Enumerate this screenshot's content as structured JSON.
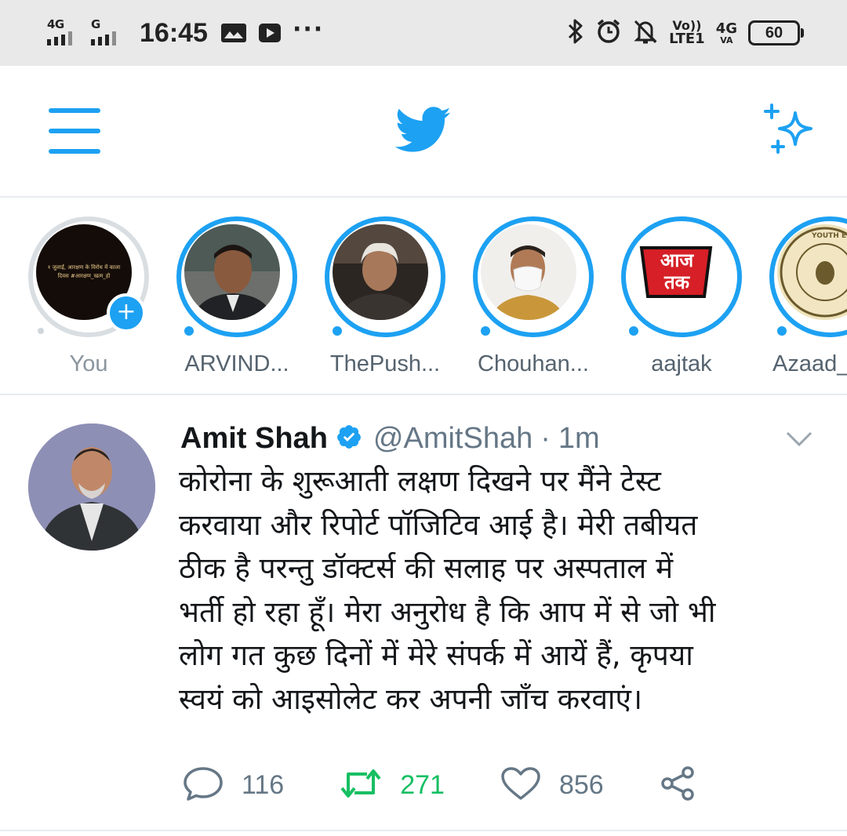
{
  "status_bar": {
    "sim1_network": "4G",
    "sim2_network": "G",
    "time": "16:45",
    "more": "···",
    "volte_top": "Vo))",
    "volte_bottom": "LTE1",
    "net_type": "4G",
    "net_sub": "VA",
    "battery": "60"
  },
  "fleets": [
    {
      "label": "You",
      "avatar_text": "१ जुलाई, आरक्षण के विरोध में काला दिवस #आरक्षण_खत्म_हो"
    },
    {
      "label": "ARVIND..."
    },
    {
      "label": "ThePush..."
    },
    {
      "label": "Chouhan..."
    },
    {
      "label": "aajtak",
      "logo_line1": "आज",
      "logo_line2": "तक"
    },
    {
      "label": "Azaad_",
      "logo_text": "YOUTH EQUALITY FOU"
    }
  ],
  "tweet": {
    "name": "Amit Shah",
    "handle": "@AmitShah",
    "separator": "·",
    "time": "1m",
    "lines": [
      "कोरोना के शुरूआती लक्षण दिखने पर मैंने टेस्ट",
      "करवाया और रिपोर्ट पॉजिटिव आई है। मेरी तबीयत",
      "ठीक है परन्तु डॉक्टर्स की सलाह पर अस्पताल में",
      "भर्ती हो रहा हूँ। मेरा अनुरोध है कि आप में से जो भी",
      "लोग गत कुछ दिनों में मेरे संपर्क में आयें हैं, कृपया",
      "स्वयं को आइसोलेट कर अपनी जाँच करवाएं।"
    ],
    "replies": "116",
    "retweets": "271",
    "likes": "856"
  },
  "colors": {
    "twitter_blue": "#1da1f2",
    "retweet_green": "#17bf63",
    "secondary_text": "#657786",
    "status_bar_bg": "#e9e9e9"
  }
}
